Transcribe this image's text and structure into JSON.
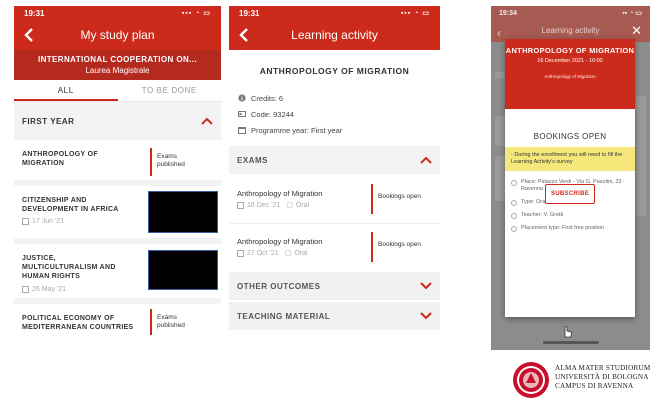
{
  "theme": {
    "accent": "#cc2a1b",
    "banner": "#b52a1f",
    "warning": "#f6e77a"
  },
  "phone1": {
    "time": "19:31",
    "title": "My study plan",
    "course": "INTERNATIONAL COOPERATION ON...",
    "degree": "Laurea Magistrale",
    "tabs": [
      "ALL",
      "TO BE DONE"
    ],
    "section": "FIRST YEAR",
    "courses": [
      {
        "name": "ANTHROPOLOGY OF MIGRATION",
        "status": "Exams published"
      },
      {
        "name": "CITIZENSHIP AND DEVELOPMENT IN AFRICA",
        "date": "17 Jun '21"
      },
      {
        "name": "JUSTICE, MULTICULTURALISM AND HUMAN RIGHTS",
        "date": "26 May '21"
      },
      {
        "name": "POLITICAL ECONOMY OF MEDITERRANEAN COUNTRIES",
        "status": "Exams published"
      }
    ]
  },
  "phone2": {
    "time": "19:31",
    "title": "Learning activity",
    "activity": "ANTHROPOLOGY OF MIGRATION",
    "credits": "Credits: 6",
    "code": "Code: 93244",
    "year": "Programme year: First year",
    "exams_header": "EXAMS",
    "exams": [
      {
        "name": "Anthropology of Migration",
        "date": "16 Dec '21",
        "type": "Oral",
        "status": "Bookings open"
      },
      {
        "name": "Anthropology of Migration",
        "date": "27 Oct '21",
        "type": "Oral",
        "status": "Bookings open"
      }
    ],
    "other_outcomes": "OTHER OUTCOMES",
    "teaching_material": "TEACHING MATERIAL"
  },
  "phone3": {
    "time": "19:34",
    "title": "Learning activity",
    "modal": {
      "course": "ANTHROPOLOGY OF MIGRATION",
      "date": "16 December 2021 - 10:00",
      "subtitle": "Anthropology of Migration",
      "status": "BOOKINGS OPEN",
      "warning": "- During the enrollment you will need to fill the Learning Activity's survey",
      "subscribe": "SUBSCRIBE",
      "place": "Place: Palazzo Verdi - Via G. Pasolini, 23 - Ravenna",
      "type": "Type: Oral",
      "teacher": "Teacher: V. Gretti",
      "placement": "Placement type: First free position"
    }
  },
  "logo": {
    "line1": "ALMA MATER STUDIORUM",
    "line2": "UNIVERSITÀ DI BOLOGNA",
    "line3": "CAMPUS DI RAVENNA"
  }
}
